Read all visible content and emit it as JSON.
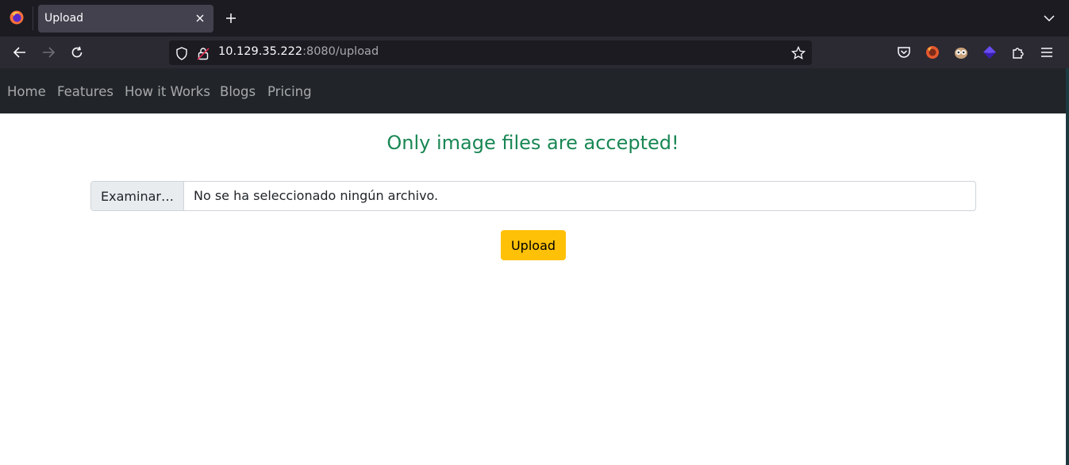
{
  "browser": {
    "tab": {
      "title": "Upload"
    },
    "url": {
      "host": "10.129.35.222",
      "rest": ":8080/upload"
    }
  },
  "site": {
    "nav": [
      "Home",
      "Features",
      "How it Works",
      "Blogs",
      "Pricing"
    ]
  },
  "main": {
    "heading": "Only image files are accepted!",
    "file_input": {
      "button_label": "Examinar…",
      "status_text": "No se ha seleccionado ningún archivo."
    },
    "upload_button": "Upload"
  },
  "colors": {
    "heading": "#198754",
    "upload_button": "#ffc107",
    "site_nav": "#212529"
  }
}
